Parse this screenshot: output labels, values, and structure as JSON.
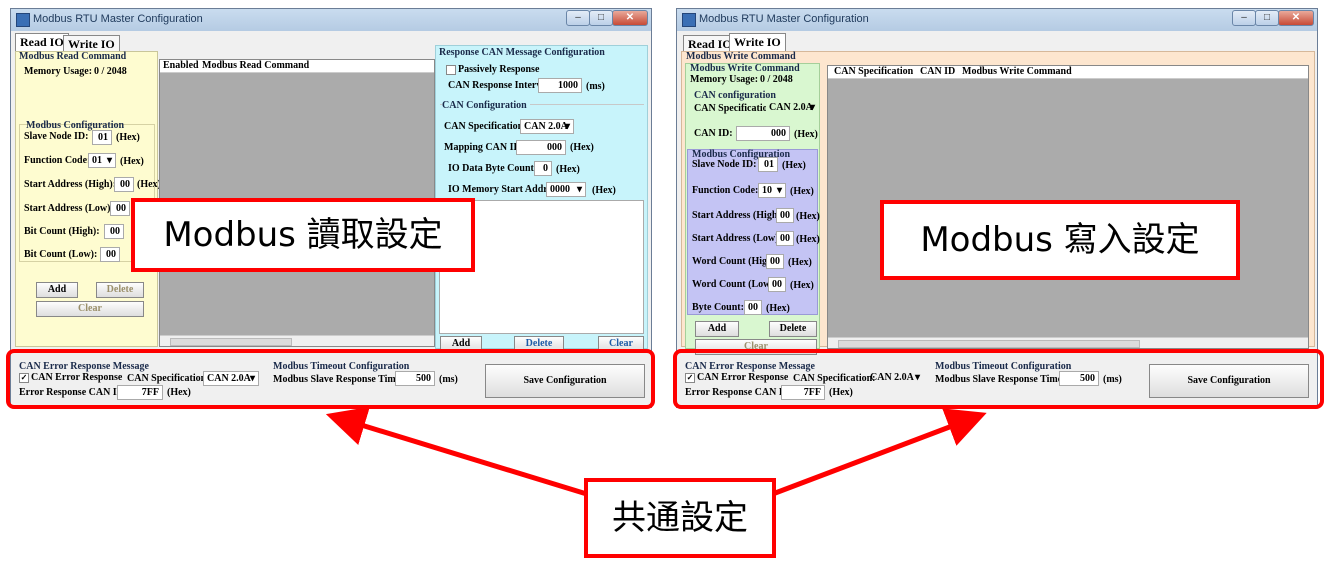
{
  "left": {
    "title": "Modbus RTU Master Configuration",
    "tabs": [
      "Read IO",
      "Write IO"
    ],
    "read_panel": {
      "title": "Modbus Read Command",
      "memory_label": "Memory Usage:",
      "memory_value": "0 / 2048",
      "config_title": "Modbus Configuration",
      "slave_label": "Slave Node ID:",
      "slave_value": "01",
      "hex": "(Hex)",
      "func_label": "Function Code:",
      "func_value": "01",
      "sah_label": "Start Address (High):",
      "sah_value": "00",
      "sal_label": "Start Address (Low):",
      "sal_value": "00",
      "bch_label": "Bit Count (High):",
      "bch_value": "00",
      "bcl_label": "Bit Count (Low):",
      "bcl_value": "00",
      "add": "Add",
      "delete": "Delete",
      "clear": "Clear"
    },
    "list_headers": [
      "Enabled",
      "Modbus Read Command"
    ],
    "can_panel": {
      "title": "Response CAN Message Configuration",
      "passive": "Passively Response",
      "interval_label": "CAN Response Interval:",
      "interval_value": "1000",
      "ms": "(ms)",
      "can_config": "CAN Configuration",
      "spec_label": "CAN Specification:",
      "spec_value": "CAN 2.0A",
      "mapping_label": "Mapping CAN ID:",
      "mapping_value": "000",
      "hex": "(Hex)",
      "byte_label": "IO Data Byte Count:",
      "byte_value": "0",
      "mem_label": "IO Memory Start Address:",
      "mem_value": "0000",
      "add": "Add",
      "delete": "Delete",
      "clear": "Clear"
    },
    "bottom": {
      "err_title": "CAN Error Response Message",
      "err_check": "CAN Error Response",
      "spec_label": "CAN Specification:",
      "spec_value": "CAN 2.0A",
      "err_id_label": "Error Response CAN ID:",
      "err_id_value": "7FF",
      "hex": "(Hex)",
      "timeout_title": "Modbus Timeout Configuration",
      "timeout_label": "Modbus Slave Response Timeout:",
      "timeout_value": "500",
      "ms": "(ms)",
      "save": "Save Configuration"
    }
  },
  "right": {
    "title": "Modbus RTU Master Configuration",
    "tabs": [
      "Read IO",
      "Write IO"
    ],
    "write_panel": {
      "outer_title": "Modbus Write Command",
      "title": "Modbus Write Command",
      "memory_label": "Memory Usage:",
      "memory_value": "0 / 2048",
      "can_config": "CAN configuration",
      "spec_label": "CAN Specification:",
      "spec_value": "CAN 2.0A",
      "canid_label": "CAN ID:",
      "canid_value": "000",
      "hex": "(Hex)",
      "config_title": "Modbus Configuration",
      "slave_label": "Slave Node ID:",
      "slave_value": "01",
      "func_label": "Function Code:",
      "func_value": "10",
      "sah_label": "Start Address (High):",
      "sah_value": "00",
      "sal_label": "Start Address (Low):",
      "sal_value": "00",
      "wch_label": "Word Count (High):",
      "wch_value": "00",
      "wcl_label": "Word Count (Low):",
      "wcl_value": "00",
      "bc_label": "Byte Count:",
      "bc_value": "00",
      "add": "Add",
      "delete": "Delete",
      "clear": "Clear"
    },
    "list_headers": [
      "CAN Specification",
      "CAN ID",
      "Modbus Write Command"
    ],
    "bottom": {
      "err_title": "CAN Error Response Message",
      "err_check": "CAN Error Response",
      "spec_label": "CAN Specification:",
      "spec_value": "CAN 2.0A",
      "err_id_label": "Error Response CAN ID:",
      "err_id_value": "7FF",
      "hex": "(Hex)",
      "timeout_title": "Modbus Timeout Configuration",
      "timeout_label": "Modbus Slave Response Timeout:",
      "timeout_value": "500",
      "ms": "(ms)",
      "save": "Save Configuration"
    }
  },
  "annotations": {
    "read_label": "Modbus 讀取設定",
    "write_label": "Modbus 寫入設定",
    "common_label": "共通設定"
  },
  "colors": {
    "highlight": "#ff0000",
    "read_panel": "#fefcd0",
    "can_panel": "#c8f4fb",
    "write_green": "#d9f7d0",
    "write_purple": "#c4c4f4",
    "write_orange": "#fde6cf"
  }
}
